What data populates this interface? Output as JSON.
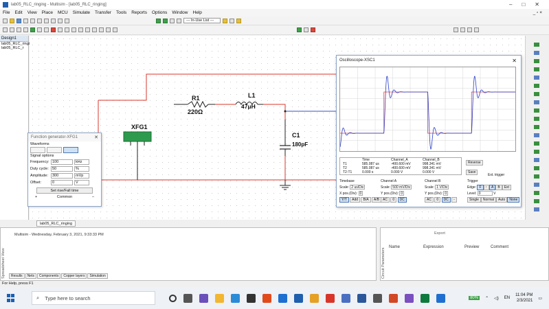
{
  "window": {
    "title": "lab05_RLC_ringing - Multisim - [lab05_RLC_ringing]",
    "controls": [
      "–",
      "□",
      "✕"
    ]
  },
  "menu": [
    "File",
    "Edit",
    "View",
    "Place",
    "MCU",
    "Simulate",
    "Transfer",
    "Tools",
    "Reports",
    "Options",
    "Window",
    "Help"
  ],
  "menu_right": "_ ▫ ×",
  "toolbar": {
    "in_use_list": "--- In-Use List ---"
  },
  "design_toolbox": {
    "title": "Design1",
    "items": [
      "lab05_RLC_ringing",
      "lab05_RLC_r"
    ]
  },
  "circuit": {
    "R1": {
      "name": "R1",
      "value": "220Ω"
    },
    "L1": {
      "name": "L1",
      "value": "47μH"
    },
    "C1": {
      "name": "C1",
      "value": "180pF"
    },
    "XFG1": {
      "name": "XFG1"
    },
    "colors": {
      "wire_red": "#d8352a",
      "wire_blue": "#3a4fc2",
      "component": "#222222"
    }
  },
  "function_generator": {
    "title": "Function generator-XFG1",
    "close": "✕",
    "waveforms_label": "Waveforms",
    "signal_options_label": "Signal options",
    "params": [
      {
        "label": "Frequency:",
        "value": "100",
        "unit": "kHz"
      },
      {
        "label": "Duty cycle:",
        "value": "50",
        "unit": "%"
      },
      {
        "label": "Amplitude:",
        "value": "300",
        "unit": "mVp"
      },
      {
        "label": "Offset:",
        "value": "0",
        "unit": "V"
      }
    ],
    "rise_fall_button": "Set rise/Fall time",
    "common_label": "Common",
    "plus": "+",
    "minus": "–"
  },
  "oscilloscope": {
    "title": "Oscilloscope-XSC1",
    "close": "✕",
    "table": {
      "headers": [
        "",
        "Time",
        "Channel_A",
        "Channel_B"
      ],
      "rows": [
        [
          "T1",
          "585.087 us",
          "-400.600 mV",
          "998.341 mV"
        ],
        [
          "T2",
          "585.087 us",
          "-400.600 mV",
          "998.341 mV"
        ],
        [
          "T2-T1",
          "0.000 s",
          "0.000 V",
          "0.000 V"
        ]
      ]
    },
    "buttons": {
      "reverse": "Reverse",
      "save": "Save",
      "ext_trigger": "Ext. trigger"
    },
    "timebase": {
      "label": "Timebase",
      "scale_label": "Scale:",
      "scale": "2 us/Div",
      "xpos_label": "X pos.(Div):",
      "xpos": "0",
      "modes": [
        "Y/T",
        "Add",
        "B/A",
        "A/B"
      ]
    },
    "channel_a": {
      "label": "Channel A",
      "scale_label": "Scale:",
      "scale": "500 mV/Div",
      "ypos_label": "Y pos.(Div):",
      "ypos": "0",
      "coupling": [
        "AC",
        "0",
        "DC"
      ]
    },
    "channel_b": {
      "label": "Channel B",
      "scale_label": "Scale:",
      "scale": "1 V/Div",
      "ypos_label": "Y pos.(Div):",
      "ypos": "0",
      "coupling": [
        "AC",
        "0",
        "DC",
        "-"
      ]
    },
    "trigger": {
      "label": "Trigger",
      "edge_label": "Edge:",
      "edge": [
        "F",
        "↑",
        "A",
        "B",
        "Ext"
      ],
      "level_label": "Level:",
      "level": "0",
      "level_unit": "V",
      "modes": [
        "Single",
        "Normal",
        "Auto",
        "None"
      ]
    },
    "colors": {
      "channel_a": "#2a3fc8",
      "channel_b": "#e04040",
      "grid": "#d6d6d6"
    }
  },
  "sheet_tab": "lab05_RLC_ringing",
  "spreadsheet": {
    "title": "Spreadsheet View",
    "message": "Multisim  -  Wednesday, February 3, 2021, 9:33:33 PM",
    "tabs": [
      "Results",
      "Nets",
      "Components",
      "Copper layers",
      "Simulation"
    ]
  },
  "circuit_params": {
    "title": "Circuit Parameters",
    "export": "Export",
    "headers": [
      "Name",
      "Expression",
      "Preview",
      "Comment"
    ]
  },
  "status": "For Help, press F1",
  "taskbar": {
    "search_placeholder": "Type here to search",
    "battery": "80%",
    "lang": "EN",
    "time": "11:04 PM",
    "date": "2/3/2021"
  }
}
